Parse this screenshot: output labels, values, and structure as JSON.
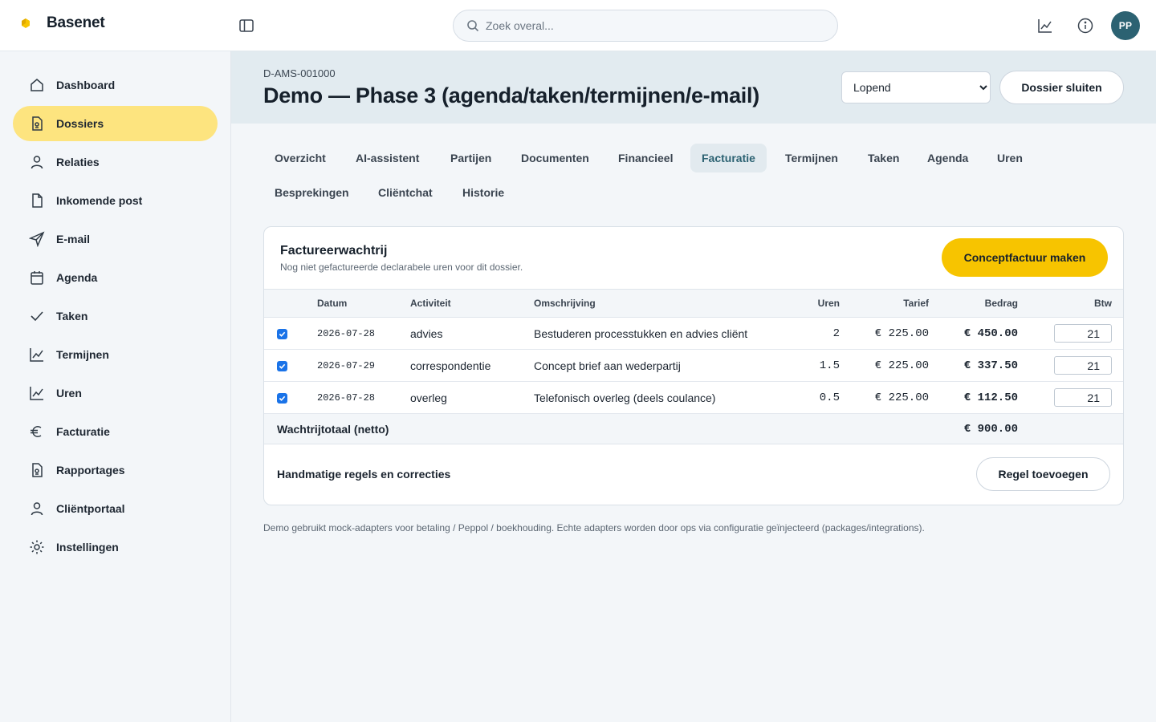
{
  "app": {
    "name": "Basenet",
    "brand_color": "#f7c400"
  },
  "search": {
    "placeholder": "Zoek overal..."
  },
  "user": {
    "initials": "PP"
  },
  "sidebar": {
    "items": [
      {
        "label": "Dashboard",
        "icon": "home-icon"
      },
      {
        "label": "Dossiers",
        "icon": "folder-file-icon",
        "active": true
      },
      {
        "label": "Relaties",
        "icon": "user-icon"
      },
      {
        "label": "Inkomende post",
        "icon": "file-icon"
      },
      {
        "label": "E-mail",
        "icon": "send-icon"
      },
      {
        "label": "Agenda",
        "icon": "calendar-icon"
      },
      {
        "label": "Taken",
        "icon": "check-icon"
      },
      {
        "label": "Termijnen",
        "icon": "chart-line-icon"
      },
      {
        "label": "Uren",
        "icon": "chart-line-icon"
      },
      {
        "label": "Facturatie",
        "icon": "euro-icon"
      },
      {
        "label": "Rapportages",
        "icon": "report-file-icon"
      },
      {
        "label": "Cliëntportaal",
        "icon": "user-icon"
      },
      {
        "label": "Instellingen",
        "icon": "settings-sun-icon"
      }
    ]
  },
  "dossier": {
    "id": "D-AMS-001000",
    "title": "Demo — Phase 3 (agenda/taken/termijnen/e-mail)",
    "status": "Lopend",
    "close_label": "Dossier sluiten"
  },
  "tabs": [
    {
      "label": "Overzicht"
    },
    {
      "label": "AI-assistent"
    },
    {
      "label": "Partijen"
    },
    {
      "label": "Documenten"
    },
    {
      "label": "Financieel"
    },
    {
      "label": "Facturatie",
      "active": true
    },
    {
      "label": "Termijnen"
    },
    {
      "label": "Taken"
    },
    {
      "label": "Agenda"
    },
    {
      "label": "Uren"
    },
    {
      "label": "Besprekingen"
    },
    {
      "label": "Cliëntchat"
    },
    {
      "label": "Historie"
    }
  ],
  "queue": {
    "title": "Factureerwachtrij",
    "subtitle": "Nog niet gefactureerde declarabele uren voor dit dossier.",
    "create_label": "Conceptfactuur maken",
    "columns": {
      "datum": "Datum",
      "activiteit": "Activiteit",
      "omschrijving": "Omschrijving",
      "uren": "Uren",
      "tarief": "Tarief",
      "bedrag": "Bedrag",
      "btw": "Btw"
    },
    "rows": [
      {
        "datum": "2026-07-28",
        "activiteit": "advies",
        "omschrijving": "Bestuderen processtukken en advies cliënt",
        "uren": "2",
        "tarief": "€ 225.00",
        "bedrag": "€ 450.00",
        "btw": "21",
        "checked": true
      },
      {
        "datum": "2026-07-29",
        "activiteit": "correspondentie",
        "omschrijving": "Concept brief aan wederpartij",
        "uren": "1.5",
        "tarief": "€ 225.00",
        "bedrag": "€ 337.50",
        "btw": "21",
        "checked": true
      },
      {
        "datum": "2026-07-28",
        "activiteit": "overleg",
        "omschrijving": "Telefonisch overleg (deels coulance)",
        "uren": "0.5",
        "tarief": "€ 225.00",
        "bedrag": "€ 112.50",
        "btw": "21",
        "checked": true
      }
    ],
    "total_label": "Wachtrijtotaal (netto)",
    "total_value": "€ 900.00",
    "manual_label": "Handmatige regels en correcties",
    "add_line_label": "Regel toevoegen"
  },
  "footnote": "Demo gebruikt mock-adapters voor betaling / Peppol / boekhouding. Echte adapters worden door ops via configuratie geïnjecteerd (packages/integrations)."
}
